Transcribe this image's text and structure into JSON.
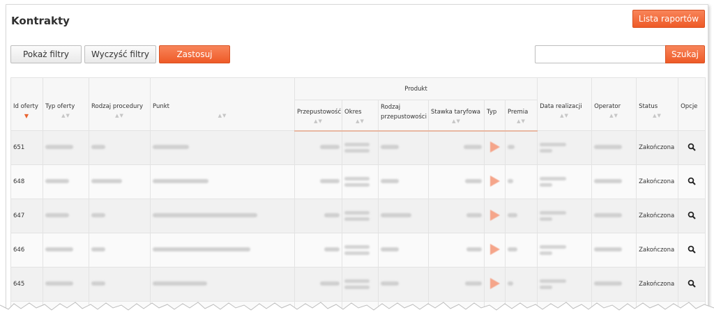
{
  "page": {
    "title": "Kontrakty",
    "reports_button": "Lista raportów",
    "show_filters": "Pokaż filtry",
    "clear_filters": "Wyczyść filtry",
    "apply": "Zastosuj",
    "search_value": "",
    "search_button": "Szukaj"
  },
  "colors": {
    "accent": "#ee5a27",
    "row_alt": "#f1f1f1"
  },
  "table": {
    "group_header": "Produkt",
    "headers": {
      "id": "Id oferty",
      "offer_type": "Typ oferty",
      "procedure": "Rodzaj procedury",
      "point": "Punkt",
      "throughput": "Przepustowość",
      "period": "Okres",
      "throughput_type_1": "Rodzaj",
      "throughput_type_2": "przepustowości",
      "tariff": "Stawka taryfowa",
      "type": "Typ",
      "bonus": "Premia",
      "date": "Data realizacji",
      "operator": "Operator",
      "status": "Status",
      "options": "Opcje"
    },
    "rows": [
      {
        "id": "651",
        "status": "Zakończona"
      },
      {
        "id": "648",
        "status": "Zakończona"
      },
      {
        "id": "647",
        "status": "Zakończona"
      },
      {
        "id": "646",
        "status": "Zakończona"
      },
      {
        "id": "645",
        "status": "Zakończona"
      }
    ]
  }
}
